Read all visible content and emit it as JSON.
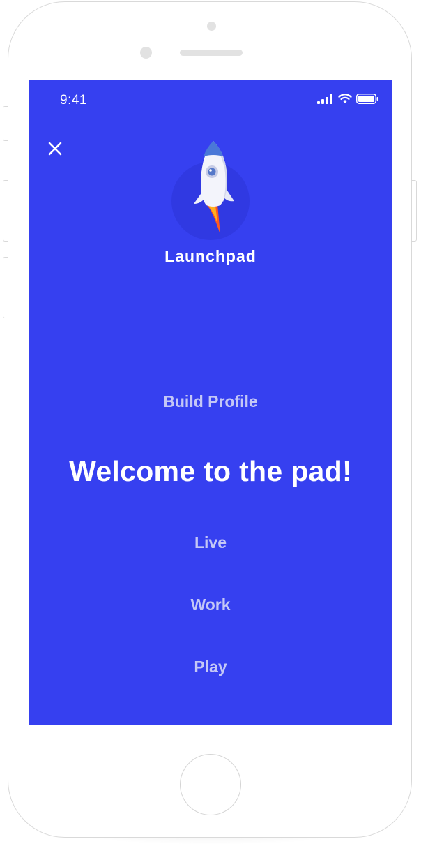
{
  "status_bar": {
    "time": "9:41",
    "icons": [
      "signal-icon",
      "wifi-icon",
      "battery-icon"
    ]
  },
  "header": {
    "close_icon": "close-icon",
    "logo_icon": "rocket-icon",
    "app_name": "Launchpad"
  },
  "menu": {
    "build_profile": "Build Profile",
    "welcome": "Welcome to the pad!",
    "live": "Live",
    "work": "Work",
    "play": "Play"
  },
  "colors": {
    "screen_background": "#3640f0",
    "primary_text": "#ffffff",
    "secondary_text": "#c4c7f6",
    "rocket_flame": "#ff5a1f"
  }
}
